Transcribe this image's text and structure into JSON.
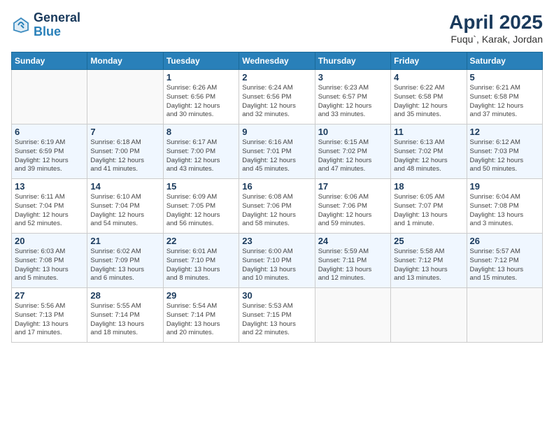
{
  "header": {
    "logo_general": "General",
    "logo_blue": "Blue",
    "title": "April 2025",
    "location": "Fuqu`, Karak, Jordan"
  },
  "weekdays": [
    "Sunday",
    "Monday",
    "Tuesday",
    "Wednesday",
    "Thursday",
    "Friday",
    "Saturday"
  ],
  "weeks": [
    [
      {
        "day": "",
        "info": ""
      },
      {
        "day": "",
        "info": ""
      },
      {
        "day": "1",
        "info": "Sunrise: 6:26 AM\nSunset: 6:56 PM\nDaylight: 12 hours\nand 30 minutes."
      },
      {
        "day": "2",
        "info": "Sunrise: 6:24 AM\nSunset: 6:56 PM\nDaylight: 12 hours\nand 32 minutes."
      },
      {
        "day": "3",
        "info": "Sunrise: 6:23 AM\nSunset: 6:57 PM\nDaylight: 12 hours\nand 33 minutes."
      },
      {
        "day": "4",
        "info": "Sunrise: 6:22 AM\nSunset: 6:58 PM\nDaylight: 12 hours\nand 35 minutes."
      },
      {
        "day": "5",
        "info": "Sunrise: 6:21 AM\nSunset: 6:58 PM\nDaylight: 12 hours\nand 37 minutes."
      }
    ],
    [
      {
        "day": "6",
        "info": "Sunrise: 6:19 AM\nSunset: 6:59 PM\nDaylight: 12 hours\nand 39 minutes."
      },
      {
        "day": "7",
        "info": "Sunrise: 6:18 AM\nSunset: 7:00 PM\nDaylight: 12 hours\nand 41 minutes."
      },
      {
        "day": "8",
        "info": "Sunrise: 6:17 AM\nSunset: 7:00 PM\nDaylight: 12 hours\nand 43 minutes."
      },
      {
        "day": "9",
        "info": "Sunrise: 6:16 AM\nSunset: 7:01 PM\nDaylight: 12 hours\nand 45 minutes."
      },
      {
        "day": "10",
        "info": "Sunrise: 6:15 AM\nSunset: 7:02 PM\nDaylight: 12 hours\nand 47 minutes."
      },
      {
        "day": "11",
        "info": "Sunrise: 6:13 AM\nSunset: 7:02 PM\nDaylight: 12 hours\nand 48 minutes."
      },
      {
        "day": "12",
        "info": "Sunrise: 6:12 AM\nSunset: 7:03 PM\nDaylight: 12 hours\nand 50 minutes."
      }
    ],
    [
      {
        "day": "13",
        "info": "Sunrise: 6:11 AM\nSunset: 7:04 PM\nDaylight: 12 hours\nand 52 minutes."
      },
      {
        "day": "14",
        "info": "Sunrise: 6:10 AM\nSunset: 7:04 PM\nDaylight: 12 hours\nand 54 minutes."
      },
      {
        "day": "15",
        "info": "Sunrise: 6:09 AM\nSunset: 7:05 PM\nDaylight: 12 hours\nand 56 minutes."
      },
      {
        "day": "16",
        "info": "Sunrise: 6:08 AM\nSunset: 7:06 PM\nDaylight: 12 hours\nand 58 minutes."
      },
      {
        "day": "17",
        "info": "Sunrise: 6:06 AM\nSunset: 7:06 PM\nDaylight: 12 hours\nand 59 minutes."
      },
      {
        "day": "18",
        "info": "Sunrise: 6:05 AM\nSunset: 7:07 PM\nDaylight: 13 hours\nand 1 minute."
      },
      {
        "day": "19",
        "info": "Sunrise: 6:04 AM\nSunset: 7:08 PM\nDaylight: 13 hours\nand 3 minutes."
      }
    ],
    [
      {
        "day": "20",
        "info": "Sunrise: 6:03 AM\nSunset: 7:08 PM\nDaylight: 13 hours\nand 5 minutes."
      },
      {
        "day": "21",
        "info": "Sunrise: 6:02 AM\nSunset: 7:09 PM\nDaylight: 13 hours\nand 6 minutes."
      },
      {
        "day": "22",
        "info": "Sunrise: 6:01 AM\nSunset: 7:10 PM\nDaylight: 13 hours\nand 8 minutes."
      },
      {
        "day": "23",
        "info": "Sunrise: 6:00 AM\nSunset: 7:10 PM\nDaylight: 13 hours\nand 10 minutes."
      },
      {
        "day": "24",
        "info": "Sunrise: 5:59 AM\nSunset: 7:11 PM\nDaylight: 13 hours\nand 12 minutes."
      },
      {
        "day": "25",
        "info": "Sunrise: 5:58 AM\nSunset: 7:12 PM\nDaylight: 13 hours\nand 13 minutes."
      },
      {
        "day": "26",
        "info": "Sunrise: 5:57 AM\nSunset: 7:12 PM\nDaylight: 13 hours\nand 15 minutes."
      }
    ],
    [
      {
        "day": "27",
        "info": "Sunrise: 5:56 AM\nSunset: 7:13 PM\nDaylight: 13 hours\nand 17 minutes."
      },
      {
        "day": "28",
        "info": "Sunrise: 5:55 AM\nSunset: 7:14 PM\nDaylight: 13 hours\nand 18 minutes."
      },
      {
        "day": "29",
        "info": "Sunrise: 5:54 AM\nSunset: 7:14 PM\nDaylight: 13 hours\nand 20 minutes."
      },
      {
        "day": "30",
        "info": "Sunrise: 5:53 AM\nSunset: 7:15 PM\nDaylight: 13 hours\nand 22 minutes."
      },
      {
        "day": "",
        "info": ""
      },
      {
        "day": "",
        "info": ""
      },
      {
        "day": "",
        "info": ""
      }
    ]
  ]
}
